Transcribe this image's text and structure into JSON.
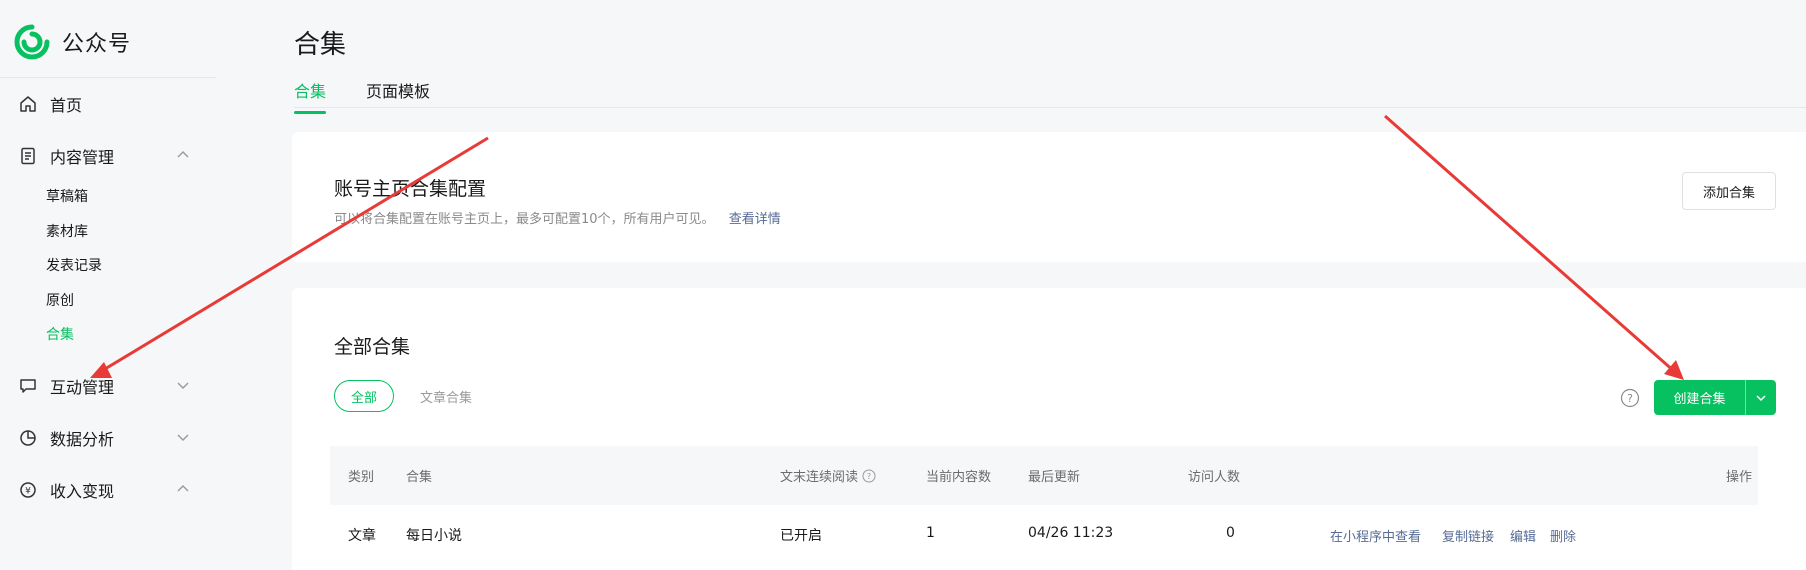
{
  "brand": {
    "name": "公众号",
    "logo_icon": "wechat-official-account-logo",
    "accent": "#07c160"
  },
  "sidebar": {
    "items": [
      {
        "label": "首页",
        "icon": "home-icon"
      },
      {
        "label": "内容管理",
        "icon": "document-icon",
        "expanded": true
      },
      {
        "label": "互动管理",
        "icon": "comment-icon",
        "expanded": false
      },
      {
        "label": "数据分析",
        "icon": "pie-chart-icon",
        "expanded": false
      },
      {
        "label": "收入变现",
        "icon": "yen-icon",
        "expanded": true
      }
    ],
    "subitems": [
      "草稿箱",
      "素材库",
      "发表记录",
      "原创",
      "合集"
    ],
    "active_subitem": "合集"
  },
  "page": {
    "title": "合集",
    "tabs": [
      {
        "label": "合集",
        "active": true
      },
      {
        "label": "页面模板",
        "active": false
      }
    ]
  },
  "config_card": {
    "title": "账号主页合集配置",
    "desc": "可以将合集配置在账号主页上，最多可配置10个，所有用户可见。",
    "link": "查看详情",
    "add_button": "添加合集"
  },
  "all_card": {
    "title": "全部合集",
    "filters": [
      {
        "label": "全部",
        "active": true
      },
      {
        "label": "文章合集",
        "active": false
      }
    ],
    "create_button": "创建合集"
  },
  "table": {
    "headers": [
      "类别",
      "合集",
      "文末连续阅读",
      "当前内容数",
      "最后更新",
      "访问人数",
      "操作"
    ],
    "rows": [
      {
        "type": "文章",
        "name": "每日小说",
        "continuous": "已开启",
        "count": "1",
        "updated": "04/26 11:23",
        "visitors": "0",
        "ops": [
          "在小程序中查看",
          "复制链接",
          "编辑",
          "删除"
        ]
      }
    ]
  },
  "colors": {
    "primary": "#07c160",
    "link": "#576b95",
    "arrow": "#e83a36"
  }
}
